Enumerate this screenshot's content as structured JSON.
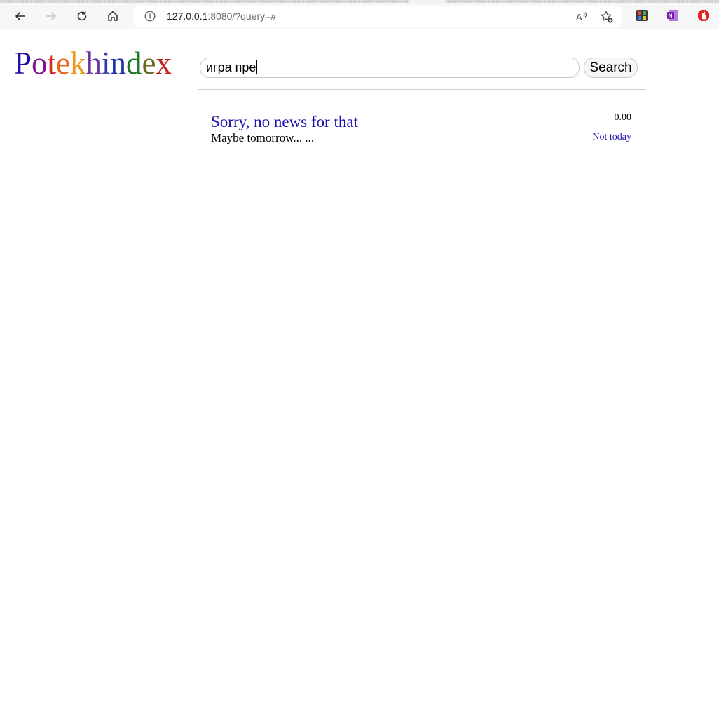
{
  "browser": {
    "url_host": "127.0.0.1",
    "url_rest": ":8080/?query=#",
    "icons": {
      "back": "back-arrow-icon",
      "forward": "forward-arrow-icon",
      "reload": "reload-icon",
      "home": "home-icon",
      "info": "info-icon",
      "read_aloud": "read-aloud-icon",
      "favorite": "add-favorite-icon",
      "extensions": [
        "extension-icon",
        "onenote-icon",
        "adblock-icon"
      ]
    }
  },
  "logo": {
    "letters": [
      {
        "char": "P",
        "color": "#1f0fa8"
      },
      {
        "char": "o",
        "color": "#7a1a8a"
      },
      {
        "char": "t",
        "color": "#d62b2b"
      },
      {
        "char": "e",
        "color": "#e8641c"
      },
      {
        "char": "k",
        "color": "#e89a1c"
      },
      {
        "char": "h",
        "color": "#6b3aa0"
      },
      {
        "char": "i",
        "color": "#2a3aa8"
      },
      {
        "char": "n",
        "color": "#1f2fa8"
      },
      {
        "char": "d",
        "color": "#1f7a2a"
      },
      {
        "char": "e",
        "color": "#6b6b1f"
      },
      {
        "char": "x",
        "color": "#c21f1f"
      }
    ]
  },
  "search": {
    "value": "игра пре",
    "button_label": "Search"
  },
  "results": [
    {
      "title": "Sorry, no news for that",
      "snippet": "Maybe tomorrow... ...",
      "score": "0.00",
      "date": "Not today"
    }
  ]
}
